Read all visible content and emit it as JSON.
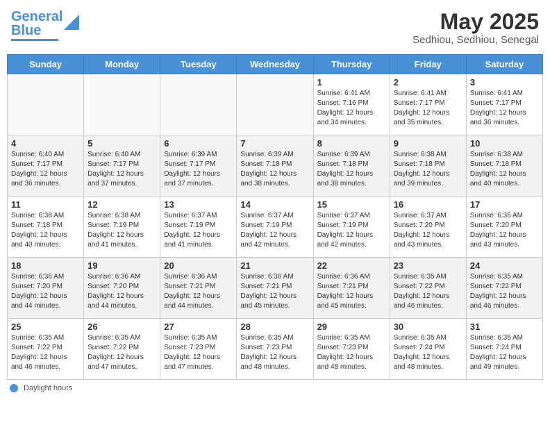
{
  "header": {
    "logo_line1": "General",
    "logo_line2": "Blue",
    "month": "May 2025",
    "location": "Sedhiou, Sedhiou, Senegal"
  },
  "days_of_week": [
    "Sunday",
    "Monday",
    "Tuesday",
    "Wednesday",
    "Thursday",
    "Friday",
    "Saturday"
  ],
  "footer": {
    "label": "Daylight hours"
  },
  "weeks": [
    [
      {
        "day": "",
        "info": ""
      },
      {
        "day": "",
        "info": ""
      },
      {
        "day": "",
        "info": ""
      },
      {
        "day": "",
        "info": ""
      },
      {
        "day": "1",
        "info": "Sunrise: 6:41 AM\nSunset: 7:16 PM\nDaylight: 12 hours\nand 34 minutes."
      },
      {
        "day": "2",
        "info": "Sunrise: 6:41 AM\nSunset: 7:17 PM\nDaylight: 12 hours\nand 35 minutes."
      },
      {
        "day": "3",
        "info": "Sunrise: 6:41 AM\nSunset: 7:17 PM\nDaylight: 12 hours\nand 36 minutes."
      }
    ],
    [
      {
        "day": "4",
        "info": "Sunrise: 6:40 AM\nSunset: 7:17 PM\nDaylight: 12 hours\nand 36 minutes."
      },
      {
        "day": "5",
        "info": "Sunrise: 6:40 AM\nSunset: 7:17 PM\nDaylight: 12 hours\nand 37 minutes."
      },
      {
        "day": "6",
        "info": "Sunrise: 6:39 AM\nSunset: 7:17 PM\nDaylight: 12 hours\nand 37 minutes."
      },
      {
        "day": "7",
        "info": "Sunrise: 6:39 AM\nSunset: 7:18 PM\nDaylight: 12 hours\nand 38 minutes."
      },
      {
        "day": "8",
        "info": "Sunrise: 6:39 AM\nSunset: 7:18 PM\nDaylight: 12 hours\nand 38 minutes."
      },
      {
        "day": "9",
        "info": "Sunrise: 6:38 AM\nSunset: 7:18 PM\nDaylight: 12 hours\nand 39 minutes."
      },
      {
        "day": "10",
        "info": "Sunrise: 6:38 AM\nSunset: 7:18 PM\nDaylight: 12 hours\nand 40 minutes."
      }
    ],
    [
      {
        "day": "11",
        "info": "Sunrise: 6:38 AM\nSunset: 7:18 PM\nDaylight: 12 hours\nand 40 minutes."
      },
      {
        "day": "12",
        "info": "Sunrise: 6:38 AM\nSunset: 7:19 PM\nDaylight: 12 hours\nand 41 minutes."
      },
      {
        "day": "13",
        "info": "Sunrise: 6:37 AM\nSunset: 7:19 PM\nDaylight: 12 hours\nand 41 minutes."
      },
      {
        "day": "14",
        "info": "Sunrise: 6:37 AM\nSunset: 7:19 PM\nDaylight: 12 hours\nand 42 minutes."
      },
      {
        "day": "15",
        "info": "Sunrise: 6:37 AM\nSunset: 7:19 PM\nDaylight: 12 hours\nand 42 minutes."
      },
      {
        "day": "16",
        "info": "Sunrise: 6:37 AM\nSunset: 7:20 PM\nDaylight: 12 hours\nand 43 minutes."
      },
      {
        "day": "17",
        "info": "Sunrise: 6:36 AM\nSunset: 7:20 PM\nDaylight: 12 hours\nand 43 minutes."
      }
    ],
    [
      {
        "day": "18",
        "info": "Sunrise: 6:36 AM\nSunset: 7:20 PM\nDaylight: 12 hours\nand 44 minutes."
      },
      {
        "day": "19",
        "info": "Sunrise: 6:36 AM\nSunset: 7:20 PM\nDaylight: 12 hours\nand 44 minutes."
      },
      {
        "day": "20",
        "info": "Sunrise: 6:36 AM\nSunset: 7:21 PM\nDaylight: 12 hours\nand 44 minutes."
      },
      {
        "day": "21",
        "info": "Sunrise: 6:36 AM\nSunset: 7:21 PM\nDaylight: 12 hours\nand 45 minutes."
      },
      {
        "day": "22",
        "info": "Sunrise: 6:36 AM\nSunset: 7:21 PM\nDaylight: 12 hours\nand 45 minutes."
      },
      {
        "day": "23",
        "info": "Sunrise: 6:35 AM\nSunset: 7:22 PM\nDaylight: 12 hours\nand 46 minutes."
      },
      {
        "day": "24",
        "info": "Sunrise: 6:35 AM\nSunset: 7:22 PM\nDaylight: 12 hours\nand 46 minutes."
      }
    ],
    [
      {
        "day": "25",
        "info": "Sunrise: 6:35 AM\nSunset: 7:22 PM\nDaylight: 12 hours\nand 46 minutes."
      },
      {
        "day": "26",
        "info": "Sunrise: 6:35 AM\nSunset: 7:22 PM\nDaylight: 12 hours\nand 47 minutes."
      },
      {
        "day": "27",
        "info": "Sunrise: 6:35 AM\nSunset: 7:23 PM\nDaylight: 12 hours\nand 47 minutes."
      },
      {
        "day": "28",
        "info": "Sunrise: 6:35 AM\nSunset: 7:23 PM\nDaylight: 12 hours\nand 48 minutes."
      },
      {
        "day": "29",
        "info": "Sunrise: 6:35 AM\nSunset: 7:23 PM\nDaylight: 12 hours\nand 48 minutes."
      },
      {
        "day": "30",
        "info": "Sunrise: 6:35 AM\nSunset: 7:24 PM\nDaylight: 12 hours\nand 48 minutes."
      },
      {
        "day": "31",
        "info": "Sunrise: 6:35 AM\nSunset: 7:24 PM\nDaylight: 12 hours\nand 49 minutes."
      }
    ]
  ]
}
